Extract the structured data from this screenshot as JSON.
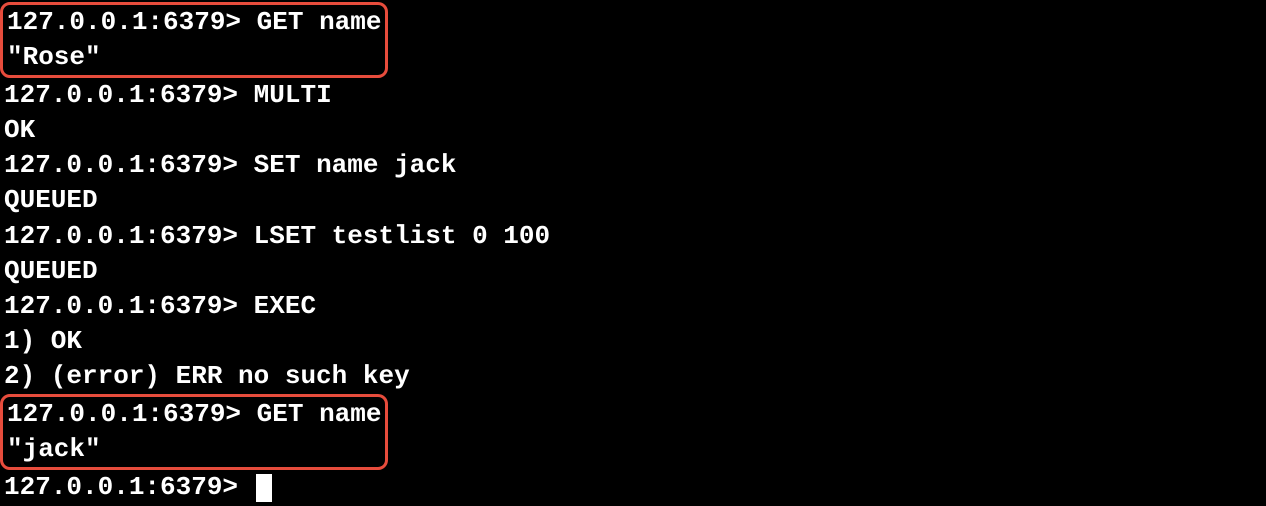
{
  "terminal": {
    "prompt": "127.0.0.1:6379>",
    "lines": [
      {
        "type": "cmd",
        "text": "GET name"
      },
      {
        "type": "out",
        "text": "\"Rose\""
      },
      {
        "type": "cmd",
        "text": "MULTI"
      },
      {
        "type": "out",
        "text": "OK"
      },
      {
        "type": "cmd",
        "text": "SET name jack"
      },
      {
        "type": "out",
        "text": "QUEUED"
      },
      {
        "type": "cmd",
        "text": "LSET testlist 0 100"
      },
      {
        "type": "out",
        "text": "QUEUED"
      },
      {
        "type": "cmd",
        "text": "EXEC"
      },
      {
        "type": "out",
        "text": "1) OK"
      },
      {
        "type": "out",
        "text": "2) (error) ERR no such key"
      },
      {
        "type": "cmd",
        "text": "GET name"
      },
      {
        "type": "out",
        "text": "\"jack\""
      },
      {
        "type": "cmd",
        "text": ""
      }
    ]
  }
}
